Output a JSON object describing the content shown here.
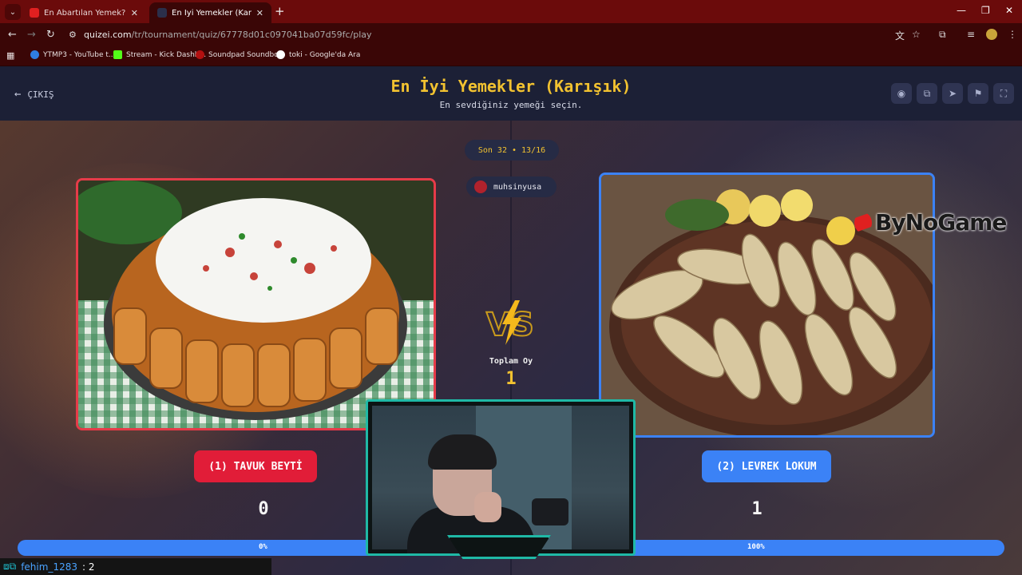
{
  "browser": {
    "tabs": [
      {
        "title": "En Abartılan Yemek? #Seçiyoruz",
        "active": false,
        "favicon_color": "#e02020"
      },
      {
        "title": "En İyi Yemekler (Karışık) - Tier L",
        "active": true,
        "favicon_color": "#2b2f4a"
      }
    ],
    "url_host": "quizei.com",
    "url_path": "/tr/tournament/quiz/67778d01c097041ba07d59fc/play",
    "bookmarks": [
      {
        "label": "YTMP3 - YouTube t...",
        "icon_color": "#2f7de1"
      },
      {
        "label": "Stream - Kick Dashb...",
        "icon_color": "#53fc18"
      },
      {
        "label": "Soundpad Soundbo...",
        "icon_color": "#b31010"
      },
      {
        "label": "toki - Google'da Ara",
        "icon_color": "#ffffff"
      }
    ]
  },
  "header": {
    "back_label": "ÇIKIŞ",
    "title": "En İyi Yemekler (Karışık)",
    "subtitle": "En sevdiğiniz yemeği seçin.",
    "action_icons": [
      "eye-icon",
      "copy-icon",
      "send-icon",
      "flag-icon",
      "fullscreen-icon"
    ]
  },
  "round": {
    "label": "Son 32 • 13/16",
    "username": "muhsinyusa"
  },
  "vs": {
    "total_label": "Toplam Oy",
    "total_value": "1"
  },
  "options": [
    {
      "label": "(1) TAVUK BEYTİ",
      "votes": "0",
      "percent_label": "0%",
      "percent": 0,
      "color": "#e11d38"
    },
    {
      "label": "(2) LEVREK LOKUM",
      "votes": "1",
      "percent_label": "100%",
      "percent": 100,
      "color": "#3b82f6"
    }
  ],
  "watermark": "ByNoGame",
  "chat": {
    "username": "fehim_1283",
    "message": ": 2"
  }
}
